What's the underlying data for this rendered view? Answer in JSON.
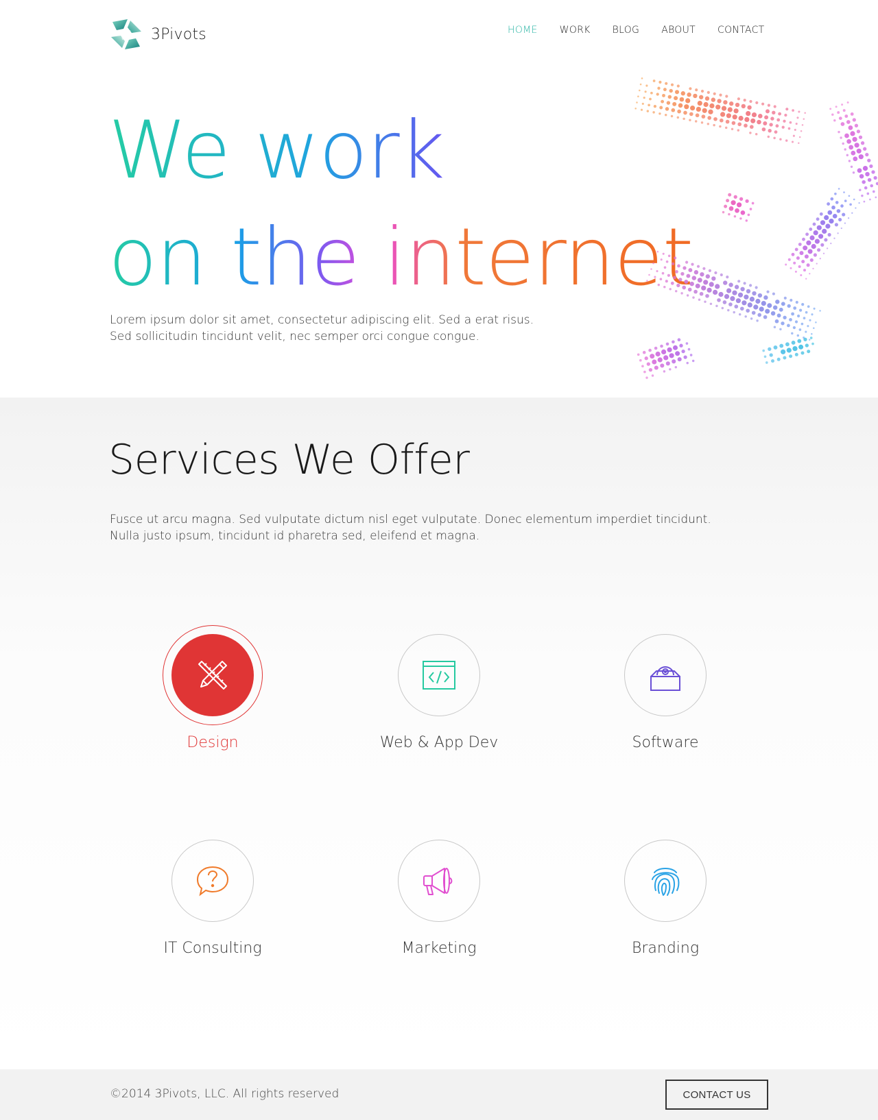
{
  "brand": {
    "name": "3Pivots",
    "logo_icon": "pinwheel-logo-icon",
    "colors": [
      "#1a8c88",
      "#6dc9b8",
      "#bfe3d8"
    ]
  },
  "nav": {
    "items": [
      {
        "label": "HOME",
        "active": true
      },
      {
        "label": "WORK",
        "active": false
      },
      {
        "label": "BLOG",
        "active": false
      },
      {
        "label": "ABOUT",
        "active": false
      },
      {
        "label": "CONTACT",
        "active": false
      }
    ],
    "active_color": "#2bb5a5"
  },
  "hero": {
    "line1": "We work",
    "line2": "on the internet",
    "description_line1": "Lorem ipsum dolor sit amet, consectetur adipiscing elit. Sed a erat risus.",
    "description_line2": "Sed sollicitudin tincidunt velit, nec semper orci congue congue.",
    "gradient_colors": [
      "#25cca3",
      "#1fa3e0",
      "#6657f0",
      "#e94bd6",
      "#f06a23"
    ]
  },
  "services": {
    "title": "Services We Offer",
    "description_line1": "Fusce ut arcu magna. Sed vulputate dictum nisl eget vulputate. Donec elementum imperdiet tincidunt.",
    "description_line2": "Nulla justo ipsum, tincidunt id pharetra sed, eleifend et magna.",
    "items": [
      {
        "label": "Design",
        "icon": "pencil-ruler-icon",
        "color": "#e03535",
        "selected": true
      },
      {
        "label": "Web & App Dev",
        "icon": "code-window-icon",
        "color": "#25c9a0",
        "selected": false
      },
      {
        "label": "Software",
        "icon": "disc-box-icon",
        "color": "#6a4fd6",
        "selected": false
      },
      {
        "label": "IT Consulting",
        "icon": "question-bubble-icon",
        "color": "#f07a2a",
        "selected": false
      },
      {
        "label": "Marketing",
        "icon": "megaphone-icon",
        "color": "#e14fd0",
        "selected": false
      },
      {
        "label": "Branding",
        "icon": "fingerprint-icon",
        "color": "#2aa3e6",
        "selected": false
      }
    ]
  },
  "footer": {
    "copyright": "©2014 3Pivots, LLC. All rights reserved",
    "button_label": "CONTACT US"
  }
}
